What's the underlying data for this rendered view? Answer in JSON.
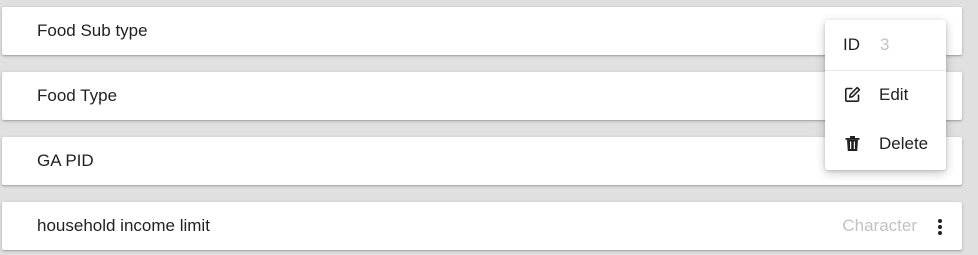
{
  "fields": [
    {
      "name": "Food Sub type",
      "type": ""
    },
    {
      "name": "Food Type",
      "type": ""
    },
    {
      "name": "GA PID",
      "type": ""
    },
    {
      "name": "household income limit",
      "type": "Character"
    }
  ],
  "menu": {
    "id_label": "ID",
    "id_value": "3",
    "items": [
      {
        "label": "Edit",
        "icon": "edit-icon"
      },
      {
        "label": "Delete",
        "icon": "trash-icon"
      }
    ]
  },
  "colors": {
    "background": "#e0e0e0",
    "card": "#ffffff",
    "text": "#222222",
    "muted_text": "#c2c2c2"
  }
}
